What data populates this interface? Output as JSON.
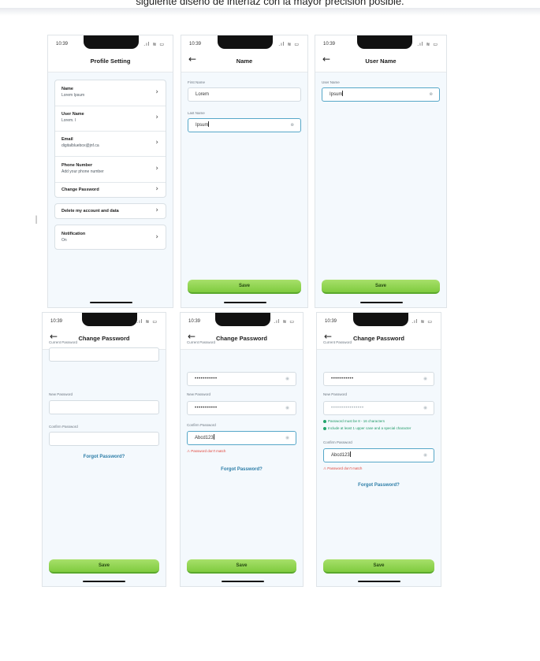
{
  "caption": "siguiente diseño de interfaz con la mayor precisión posible.",
  "status": {
    "time": "10:39",
    "icons": "signal wifi battery"
  },
  "back_arrow": "←",
  "chevron": "›",
  "profile": {
    "title": "Profile Setting",
    "items": [
      {
        "title": "Name",
        "sub": "Lorem Ipsum"
      },
      {
        "title": "User Name",
        "sub": "Lorem. I"
      },
      {
        "title": "Email",
        "sub": "digitalbluebox@jnf.ca"
      },
      {
        "title": "Phone Number",
        "sub": "Add your phone number"
      },
      {
        "title": "Change Password",
        "sub": ""
      }
    ],
    "delete_label": "Delete my account and data",
    "notification": {
      "title": "Notification",
      "sub": "On"
    }
  },
  "name_screen": {
    "title": "Name",
    "first_label": "First Name",
    "first_value": "Lorem",
    "last_label": "Last Name",
    "last_value": "Ipsum",
    "save": "Save"
  },
  "username_screen": {
    "title": "User Name",
    "label": "User Name",
    "value": "Ipsum",
    "save": "Save"
  },
  "change_password": {
    "title": "Change Password",
    "current_label": "Current Password",
    "new_label": "New Password",
    "confirm_label": "Confirm Password",
    "forgot": "Forgot Password?",
    "save": "Save",
    "masked": "•••••••••••",
    "masked_long": "••••••••••••••••",
    "confirm_value": "Abcd123",
    "mismatch": "⚠ Password don't match",
    "rule_length": "Password must be 8 - 16 characters",
    "rule_case": "Include at least 1 upper case and a special character"
  }
}
